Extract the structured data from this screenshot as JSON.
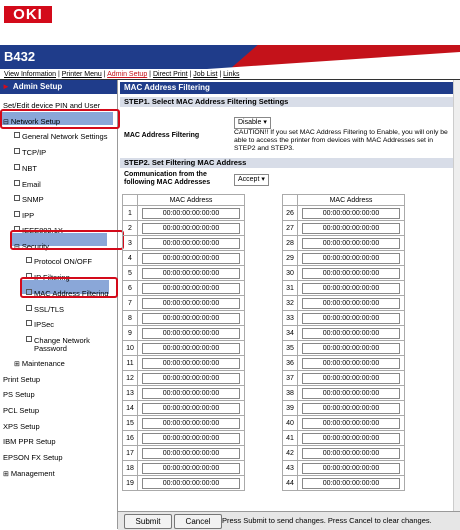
{
  "header": {
    "logo": "OKI",
    "model": "B432"
  },
  "nav": [
    "View Information",
    "Printer Menu",
    "Admin Setup",
    "Direct Print",
    "Job List",
    "Links"
  ],
  "nav_active": "Admin Setup",
  "sidebar": {
    "title": "Admin Setup",
    "items": [
      {
        "label": "Set/Edit device PIN and User",
        "level": 0
      },
      {
        "label": "Network Setup",
        "level": 0
      },
      {
        "label": "General Network Settings",
        "level": 1
      },
      {
        "label": "TCP/IP",
        "level": 1
      },
      {
        "label": "NBT",
        "level": 1
      },
      {
        "label": "Email",
        "level": 1
      },
      {
        "label": "SNMP",
        "level": 1
      },
      {
        "label": "IPP",
        "level": 1
      },
      {
        "label": "IEEE802.1X",
        "level": 1
      },
      {
        "label": "Security",
        "level": 1
      },
      {
        "label": "Protocol ON/OFF",
        "level": 2
      },
      {
        "label": "IP Filtering",
        "level": 2
      },
      {
        "label": "MAC Address Filtering",
        "level": 2
      },
      {
        "label": "SSL/TLS",
        "level": 2
      },
      {
        "label": "IPSec",
        "level": 2
      },
      {
        "label": "Change Network",
        "level": 2
      },
      {
        "label": "Password",
        "level": 2
      },
      {
        "label": "Maintenance",
        "level": 1
      },
      {
        "label": "Print Setup",
        "level": 0
      },
      {
        "label": "PS Setup",
        "level": 0
      },
      {
        "label": "PCL Setup",
        "level": 0
      },
      {
        "label": "XPS Setup",
        "level": 0
      },
      {
        "label": "IBM PPR Setup",
        "level": 0
      },
      {
        "label": "EPSON FX Setup",
        "level": 0
      },
      {
        "label": "Management",
        "level": 0
      }
    ]
  },
  "main": {
    "title": "MAC Address Filtering",
    "step1": "STEP1.  Select MAC Address Filtering Settings",
    "filtering_label": "MAC Address Filtering",
    "filtering_value": "Disable",
    "caution": "CAUTION!! If you set MAC Address Filtering to Enable, you will only be able to access the printer from devices with MAC Addresses set in STEP2 and STEP3.",
    "step2": "STEP2.  Set Filtering MAC Address",
    "comm_label1": "Communication from the",
    "comm_label2": "following MAC Addresses",
    "comm_value": "Accept",
    "col_header": "MAC Address",
    "mac_default": "00:00:00:00:00:00",
    "left_rows": [
      "1",
      "2",
      "3",
      "4",
      "5",
      "6",
      "7",
      "8",
      "9",
      "10",
      "11",
      "12",
      "13",
      "14",
      "15",
      "16",
      "17",
      "18",
      "19"
    ],
    "right_rows": [
      "26",
      "27",
      "28",
      "29",
      "30",
      "31",
      "32",
      "33",
      "34",
      "35",
      "36",
      "37",
      "38",
      "39",
      "40",
      "41",
      "42",
      "43",
      "44"
    ]
  },
  "footer": {
    "submit": "Submit",
    "cancel": "Cancel",
    "message": "Press Submit to send changes. Press Cancel to clear changes."
  }
}
